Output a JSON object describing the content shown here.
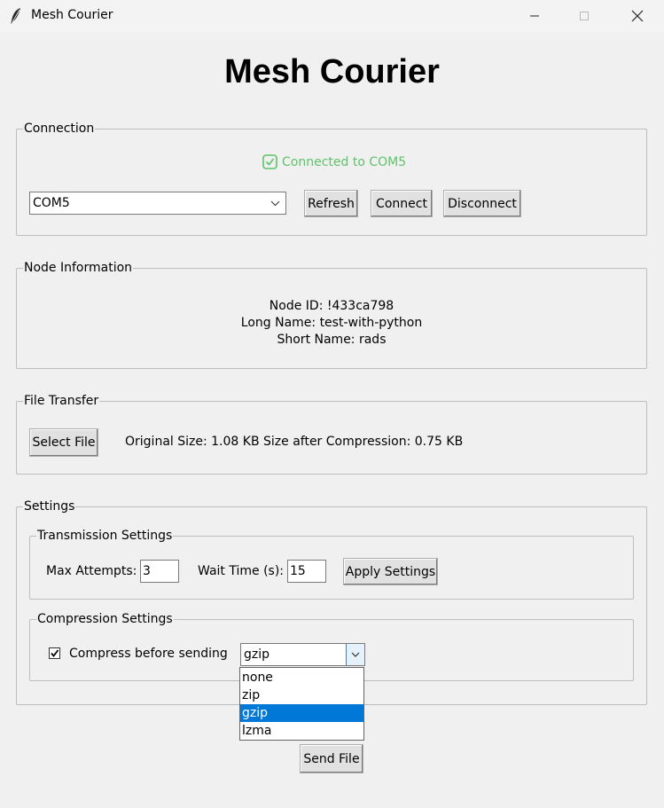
{
  "window": {
    "title": "Mesh Courier",
    "minimize_icon": "minimize-icon",
    "maximize_icon": "maximize-icon",
    "close_icon": "close-icon"
  },
  "heading": "Mesh Courier",
  "connection": {
    "legend": "Connection",
    "status": "Connected to COM5",
    "status_color": "#5ec26a",
    "port_selected": "COM5",
    "refresh_label": "Refresh",
    "connect_label": "Connect",
    "disconnect_label": "Disconnect"
  },
  "node_info": {
    "legend": "Node Information",
    "node_id": "Node ID: !433ca798",
    "long_name": "Long Name: test-with-python",
    "short_name": "Short Name: rads"
  },
  "file_transfer": {
    "legend": "File Transfer",
    "select_label": "Select File",
    "original_size": "Original Size: 1.08 KB",
    "compressed_size": "Size after Compression: 0.75 KB"
  },
  "settings": {
    "legend": "Settings",
    "transmission": {
      "legend": "Transmission Settings",
      "max_attempts_label": "Max Attempts:",
      "max_attempts_value": "3",
      "wait_time_label": "Wait Time (s):",
      "wait_time_value": "15",
      "apply_label": "Apply Settings"
    },
    "compression": {
      "legend": "Compression Settings",
      "checkbox_label": "Compress before sending",
      "checked": true,
      "method_selected": "gzip",
      "options": [
        "none",
        "zip",
        "gzip",
        "lzma"
      ],
      "highlight_color": "#0078d7"
    }
  },
  "send_label": "Send File"
}
